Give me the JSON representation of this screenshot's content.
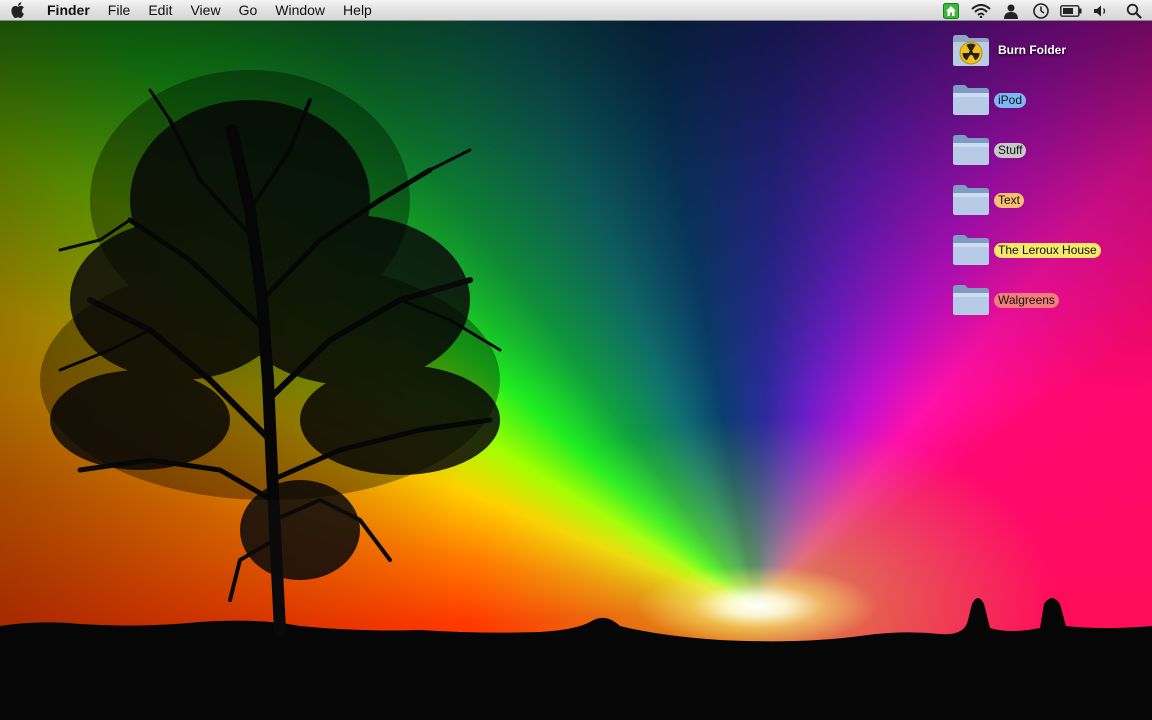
{
  "menubar": {
    "apple_icon": "apple-logo-icon",
    "app_name": "Finder",
    "menus": [
      "File",
      "Edit",
      "View",
      "Go",
      "Window",
      "Help"
    ],
    "status_icons": [
      "home-icon",
      "wifi-icon",
      "user-icon",
      "clock-icon",
      "battery-icon",
      "volume-icon",
      "spotlight-search-icon"
    ]
  },
  "desktop": {
    "wallpaper": "rainbow sunset with tree silhouette",
    "icons": [
      {
        "label": "Burn Folder",
        "icon": "burn-folder-icon",
        "label_color": ""
      },
      {
        "label": "iPod",
        "icon": "folder-icon",
        "label_color": "#7db8f5"
      },
      {
        "label": "Stuff",
        "icon": "folder-icon",
        "label_color": "#c8c8c8"
      },
      {
        "label": "Text",
        "icon": "folder-icon",
        "label_color": "#f8c070"
      },
      {
        "label": "The Leroux House",
        "icon": "folder-icon",
        "label_color": "#f5e96a"
      },
      {
        "label": "Walgreens",
        "icon": "folder-icon",
        "label_color": "#f47c7c"
      }
    ]
  },
  "colors": {
    "menubar_bg": "#e2e2e2",
    "home_icon_green": "#3cb83c"
  }
}
